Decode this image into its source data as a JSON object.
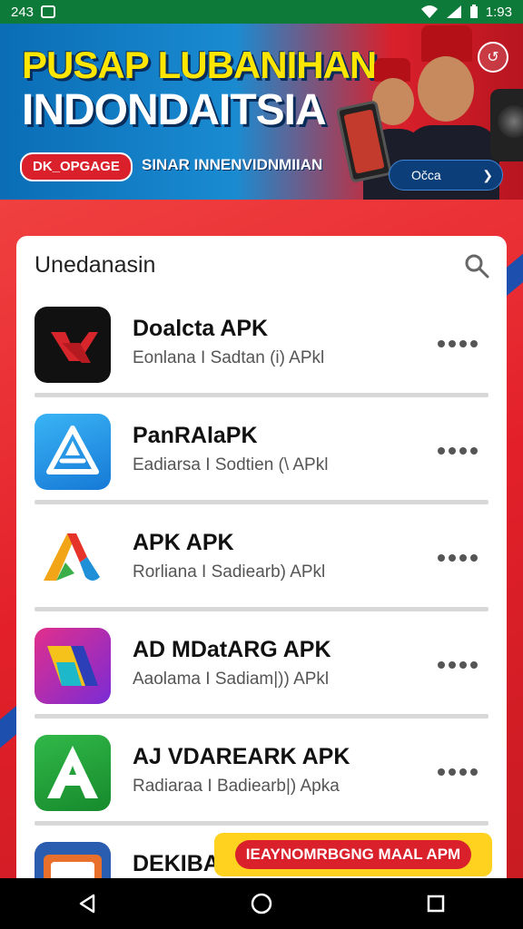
{
  "status_bar": {
    "left_text": "243",
    "time": "1:93"
  },
  "banner": {
    "title_line1": "PUSAP LUBANIHAN",
    "title_line2": "INDONDAITSIA",
    "pill_label": "DK_OPGAGE",
    "subtitle": "SINAR INNENVIDNMIIAN",
    "cta_label": "Očca"
  },
  "list": {
    "header": "Unedanasin",
    "apps": [
      {
        "name": "Doalcta APK",
        "subtitle": "Eonlana I Sadtan (i) APkl",
        "icon": "vk-icon",
        "color": "#111111"
      },
      {
        "name": "PanRAlaPK",
        "subtitle": "Eadiarsa I Sodtien (\\ APkl",
        "icon": "app-store-icon",
        "color": "#1e9be9"
      },
      {
        "name": "APK APK",
        "subtitle": "Rorliana I Sadiearb) APkl",
        "icon": "colorful-a-icon",
        "color": "#ffffff"
      },
      {
        "name": "AD MDatARG APK",
        "subtitle": "Aaolama I Sadiam|)) APkl",
        "icon": "triangle-icon",
        "color": "#7a2bd6"
      },
      {
        "name": "AJ VDAREARK APK",
        "subtitle": "Radiaraa I Badiearb|) Apka",
        "icon": "green-a-icon",
        "color": "#23a03a"
      },
      {
        "name": "DEKIBA",
        "subtitle": "",
        "icon": "folder-icon",
        "color": "#2a5db0"
      }
    ]
  },
  "promo": {
    "label": "IEAYNOMRBGNG MAAL APM"
  }
}
